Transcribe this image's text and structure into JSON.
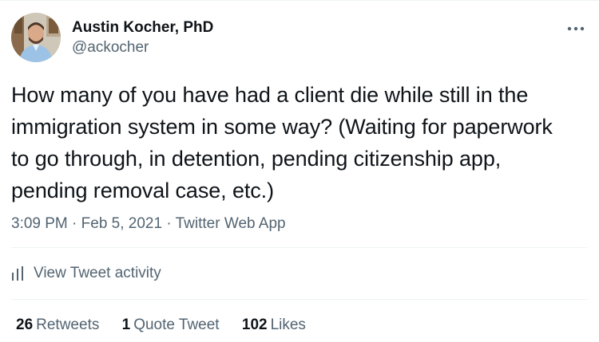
{
  "tweet": {
    "author": {
      "name": "Austin Kocher, PhD",
      "handle": "@ackocher"
    },
    "text": "How many of you have had a client die while still in the\nimmigration system in some way? (Waiting for paperwork\nto go through, in detention, pending citizenship app,\npending removal case, etc.)",
    "time": "3:09 PM",
    "date": "Feb 5, 2021",
    "source": "Twitter Web App",
    "separator": "·",
    "more_icon": "more-horizontal-icon",
    "activity": {
      "icon": "bar-chart-icon",
      "label": "View Tweet activity"
    },
    "stats": {
      "retweets": {
        "count": "26",
        "label": "Retweets"
      },
      "quotes": {
        "count": "1",
        "label": "Quote Tweet"
      },
      "likes": {
        "count": "102",
        "label": "Likes"
      }
    }
  },
  "colors": {
    "text": "#0f1419",
    "secondary": "#536471",
    "divider": "#eff3f4"
  }
}
